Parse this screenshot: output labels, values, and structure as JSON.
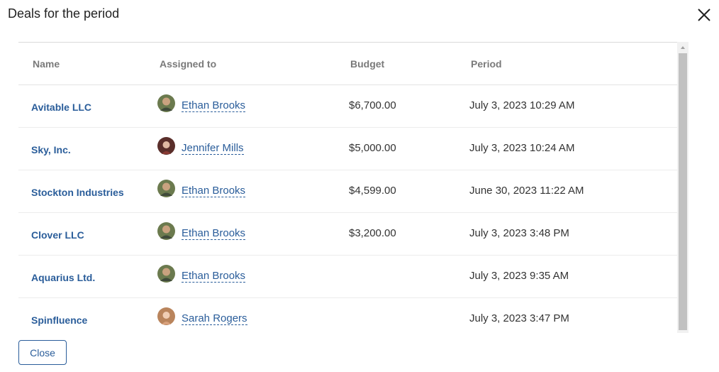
{
  "dialog": {
    "title": "Deals for the period"
  },
  "table": {
    "headers": {
      "name": "Name",
      "assigned": "Assigned to",
      "budget": "Budget",
      "period": "Period"
    },
    "rows": [
      {
        "name": "Avitable LLC",
        "assigned": "Ethan Brooks",
        "budget": "$6,700.00",
        "period": "July 3, 2023 10:29 AM",
        "avatar": "man"
      },
      {
        "name": "Sky, Inc.",
        "assigned": "Jennifer Mills",
        "budget": "$5,000.00",
        "period": "July 3, 2023 10:24 AM",
        "avatar": "woman-dark"
      },
      {
        "name": "Stockton Industries",
        "assigned": "Ethan Brooks",
        "budget": "$4,599.00",
        "period": "June 30, 2023 11:22 AM",
        "avatar": "man"
      },
      {
        "name": "Clover LLC",
        "assigned": "Ethan Brooks",
        "budget": "$3,200.00",
        "period": "July 3, 2023 3:48 PM",
        "avatar": "man"
      },
      {
        "name": "Aquarius Ltd.",
        "assigned": "Ethan Brooks",
        "budget": "",
        "period": "July 3, 2023 9:35 AM",
        "avatar": "man"
      },
      {
        "name": "Spinfluence",
        "assigned": "Sarah Rogers",
        "budget": "",
        "period": "July 3, 2023 3:47 PM",
        "avatar": "woman-light"
      }
    ]
  },
  "footer": {
    "close_label": "Close"
  },
  "colors": {
    "link": "#2a5d9a",
    "header_text": "#7a7a7a",
    "scrollbar_thumb": "#c1c1c1"
  }
}
